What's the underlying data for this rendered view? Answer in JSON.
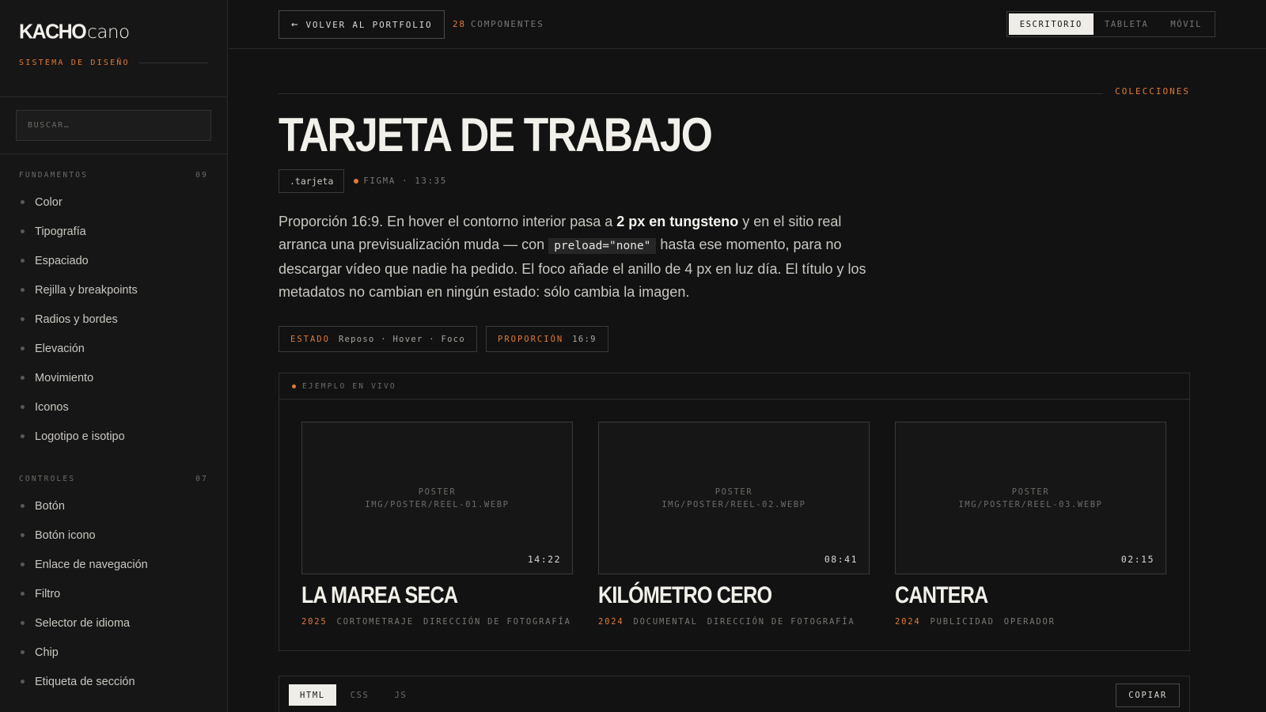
{
  "brand": {
    "logo_bold": "KACHO",
    "logo_light": "cano",
    "subtitle": "SISTEMA DE DISEÑO"
  },
  "search": {
    "placeholder": "BUSCAR…"
  },
  "nav": {
    "groups": [
      {
        "title": "FUNDAMENTOS",
        "count": "09",
        "items": [
          "Color",
          "Tipografía",
          "Espaciado",
          "Rejilla y breakpoints",
          "Radios y bordes",
          "Elevación",
          "Movimiento",
          "Iconos",
          "Logotipo e isotipo"
        ]
      },
      {
        "title": "CONTROLES",
        "count": "07",
        "items": [
          "Botón",
          "Botón icono",
          "Enlace de navegación",
          "Filtro",
          "Selector de idioma",
          "Chip",
          "Etiqueta de sección"
        ]
      }
    ]
  },
  "topbar": {
    "back_label": "VOLVER AL PORTFOLIO",
    "component_count": "28",
    "component_label": "COMPONENTES",
    "viewports": [
      "ESCRITORIO",
      "TABLETA",
      "MÓVIL"
    ],
    "active_viewport": "ESCRITORIO"
  },
  "page": {
    "section": "COLECCIONES",
    "title": "TARJETA DE TRABAJO",
    "class_tag": ".tarjeta",
    "figma_label": "FIGMA · 13:35",
    "desc": {
      "p1": "Proporción 16:9. En hover el contorno interior pasa a ",
      "strong": "2 px en tungsteno",
      "p2": " y en el sitio real arranca una previsualización muda — con ",
      "code": "preload=\"none\"",
      "p3": " hasta ese momento, para no descargar vídeo que nadie ha pedido. El foco añade el anillo de 4 px en luz día. El título y los metadatos no cambian en ningún estado: sólo cambia la imagen."
    },
    "props": [
      {
        "key": "ESTADO",
        "value": "Reposo · Hover · Foco"
      },
      {
        "key": "PROPORCIÓN",
        "value": "16:9"
      }
    ]
  },
  "live": {
    "label": "EJEMPLO EN VIVO",
    "cards": [
      {
        "poster_label": "POSTER",
        "poster_path": "IMG/POSTER/REEL-01.WEBP",
        "duration": "14:22",
        "title": "LA MAREA SECA",
        "year": "2025",
        "type": "CORTOMETRAJE",
        "role": "DIRECCIÓN DE FOTOGRAFÍA"
      },
      {
        "poster_label": "POSTER",
        "poster_path": "IMG/POSTER/REEL-02.WEBP",
        "duration": "08:41",
        "title": "KILÓMETRO CERO",
        "year": "2024",
        "type": "DOCUMENTAL",
        "role": "DIRECCIÓN DE FOTOGRAFÍA"
      },
      {
        "poster_label": "POSTER",
        "poster_path": "IMG/POSTER/REEL-03.WEBP",
        "duration": "02:15",
        "title": "CANTERA",
        "year": "2024",
        "type": "PUBLICIDAD",
        "role": "OPERADOR"
      }
    ]
  },
  "code": {
    "tabs": [
      "HTML",
      "CSS",
      "JS"
    ],
    "active_tab": "HTML",
    "copy_label": "COPIAR"
  },
  "colors": {
    "accent": "#e07a3a",
    "background": "#121212",
    "sidebar": "#161616",
    "text": "#e8e6e1"
  }
}
